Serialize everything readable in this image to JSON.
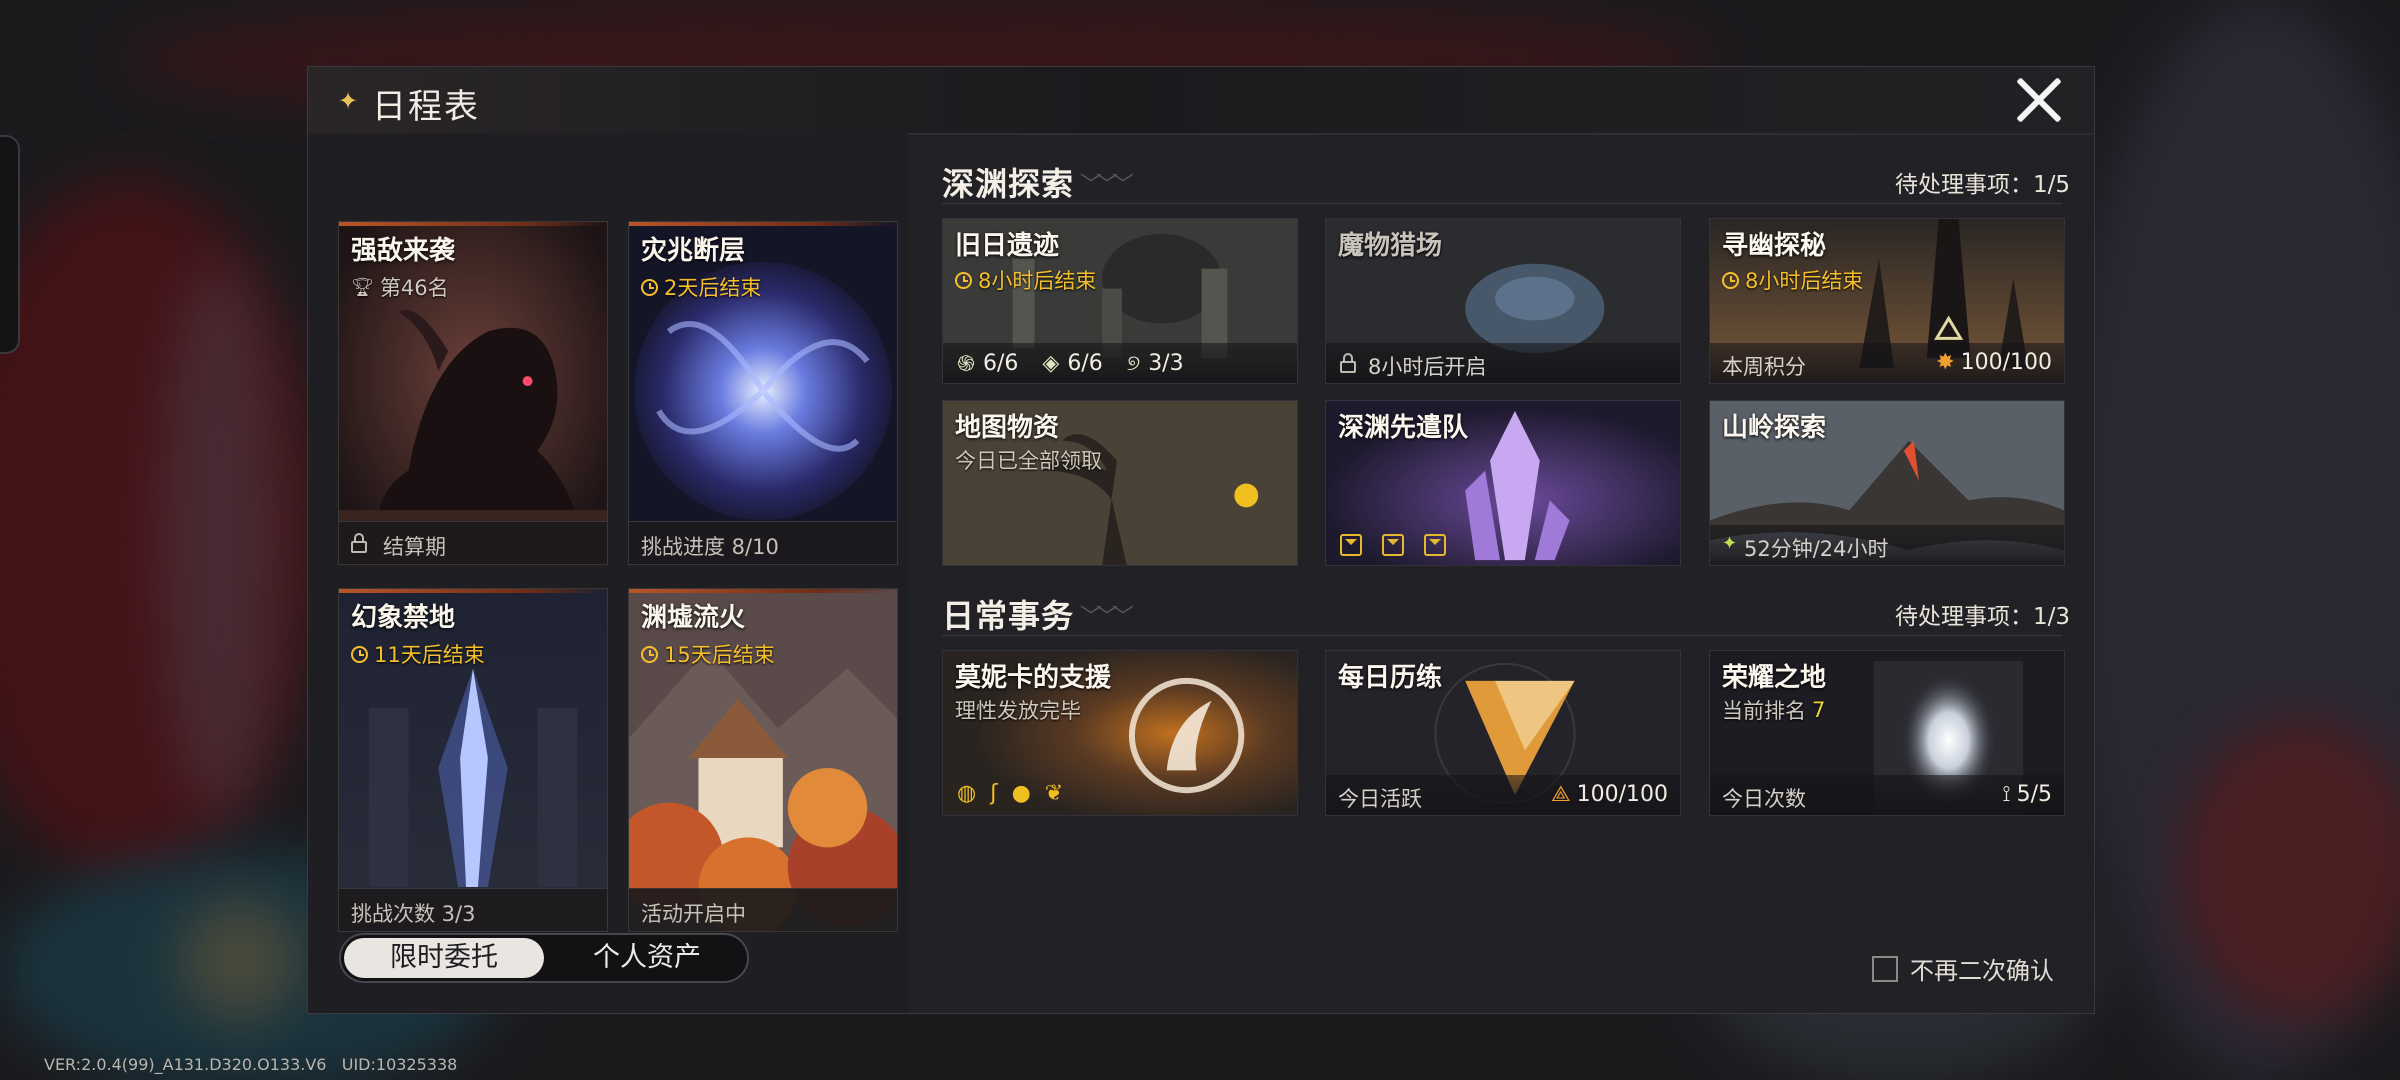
{
  "header": {
    "title": "日程表"
  },
  "events": [
    {
      "name": "强敌来袭",
      "sub": "第46名",
      "sub_icon": "trophy-icon",
      "footer": "结算期",
      "footer_icon": "lock-icon"
    },
    {
      "name": "灾兆断层",
      "sub": "2天后结束",
      "sub_icon": "clock-icon",
      "footer": "挑战进度 8/10"
    },
    {
      "name": "幻象禁地",
      "sub": "11天后结束",
      "sub_icon": "clock-icon",
      "footer": "挑战次数 3/3"
    },
    {
      "name": "渊墟流火",
      "sub": "15天后结束",
      "sub_icon": "clock-icon",
      "footer": "活动开启中"
    }
  ],
  "abyss": {
    "title": "深渊探索",
    "pending_label": "待处理事项：",
    "pending_value": "1/5",
    "tiles": [
      {
        "name": "旧日遗迹",
        "sub": "8小时后结束",
        "stats": [
          "6/6",
          "6/6",
          "3/3"
        ]
      },
      {
        "name": "魔物猎场",
        "footer": "8小时后开启"
      },
      {
        "name": "寻幽探秘",
        "sub": "8小时后结束",
        "footer_label": "本周积分",
        "footer_value": "100/100"
      },
      {
        "name": "地图物资",
        "sub": "今日已全部领取"
      },
      {
        "name": "深渊先遣队"
      },
      {
        "name": "山岭探索",
        "footer": "52分钟/24小时"
      }
    ]
  },
  "daily": {
    "title": "日常事务",
    "pending_label": "待处理事项：",
    "pending_value": "1/3",
    "tiles": [
      {
        "name": "莫妮卡的支援",
        "sub": "理性发放完毕"
      },
      {
        "name": "每日历练",
        "footer_label": "今日活跃",
        "footer_value": "100/100"
      },
      {
        "name": "荣耀之地",
        "sub_label": "当前排名",
        "sub_value": "7",
        "footer_label": "今日次数",
        "footer_value": "5/5"
      }
    ]
  },
  "tabs": {
    "active": "限时委托",
    "inactive": "个人资产"
  },
  "confirm_label": "不再二次确认",
  "version": "VER:2.0.4(99)_A131.D320.O133.V6",
  "uid": "UID:10325338",
  "colors": {
    "accent_yellow": "#f5bf2c",
    "panel": "#222226",
    "header_star": "#e9c257"
  }
}
